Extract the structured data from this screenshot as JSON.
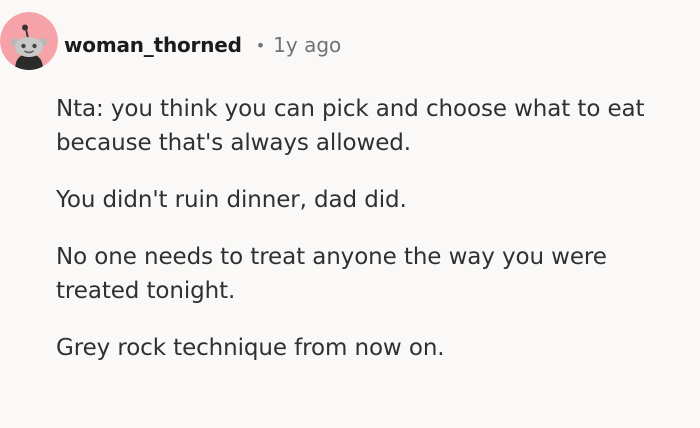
{
  "comment": {
    "author": "woman_thorned",
    "separator": "•",
    "age": "1y ago",
    "avatar_icon": "snoo-avatar-icon",
    "avatar_color": "#f5a3a8",
    "paragraphs": [
      "Nta: you think you can pick and choose what to eat because that's always allowed.",
      "You didn't ruin dinner, dad did.",
      "No one needs to treat anyone the way you were treated tonight.",
      "Grey rock technique from now on."
    ]
  }
}
